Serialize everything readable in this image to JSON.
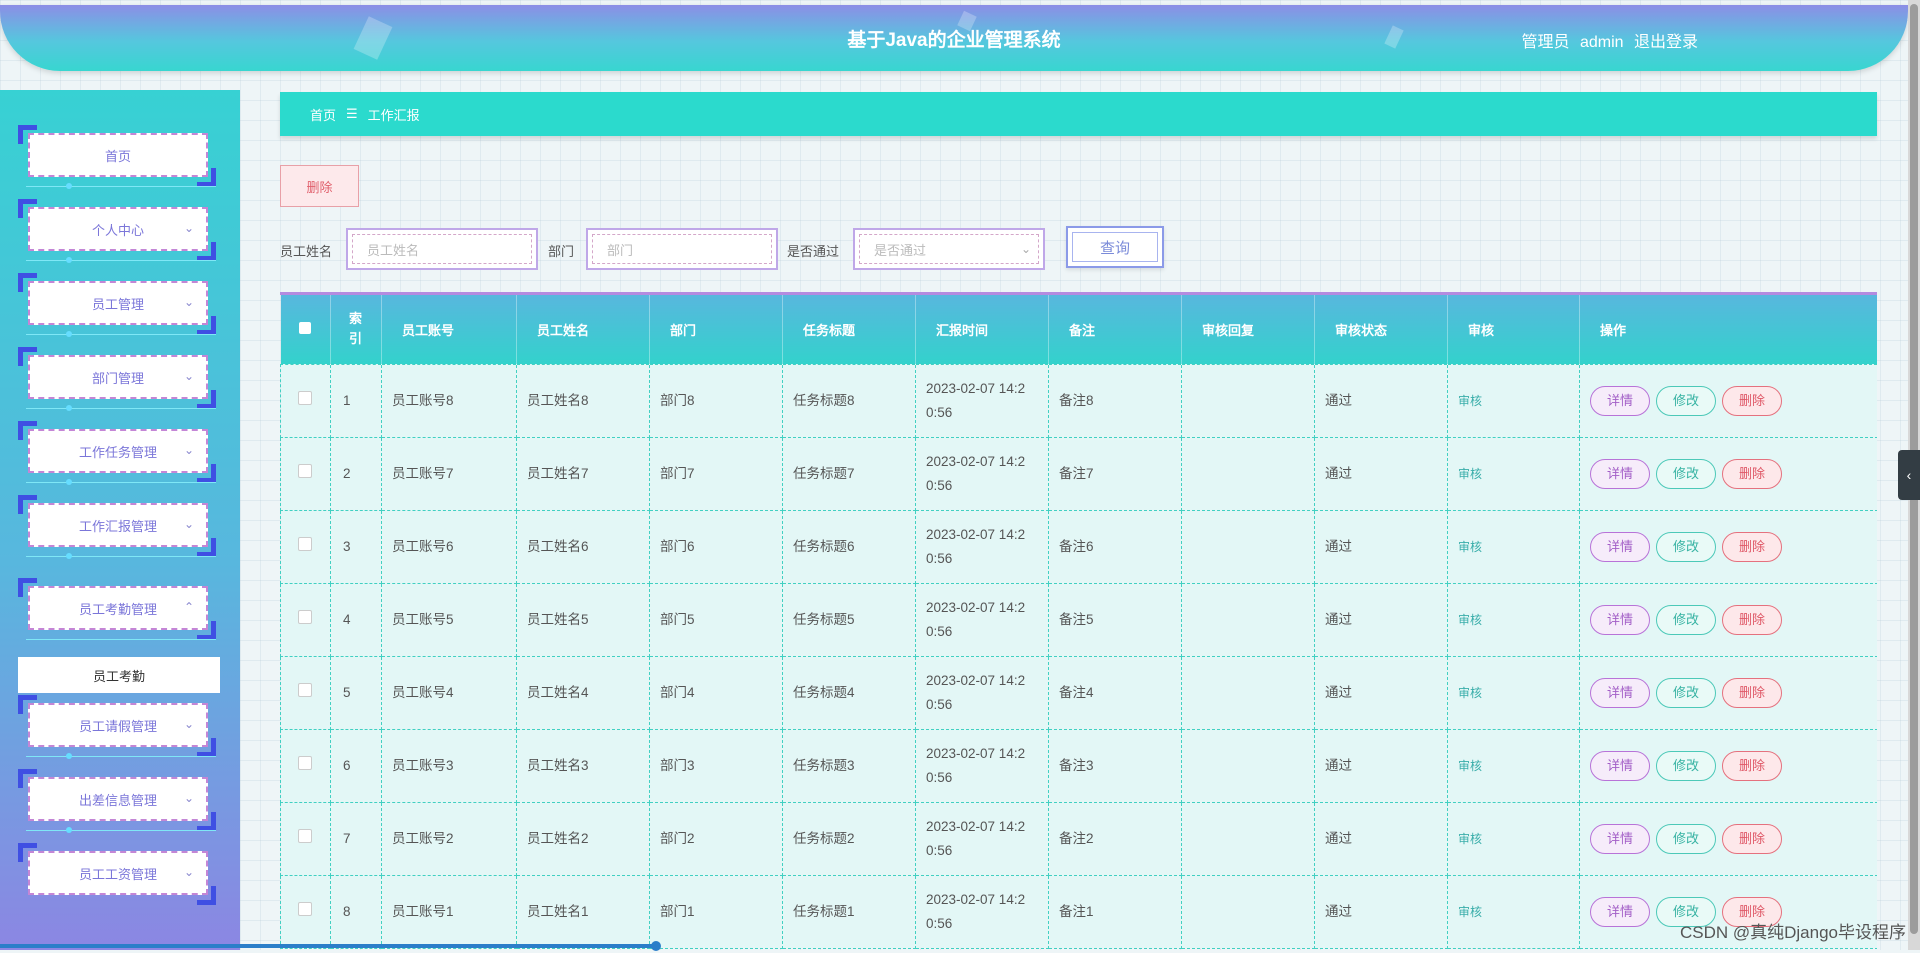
{
  "header": {
    "title": "基于Java的企业管理系统",
    "role": "管理员",
    "username": "admin",
    "logout_label": "退出登录"
  },
  "sidebar": {
    "items": [
      {
        "label": "首页"
      },
      {
        "label": "个人中心"
      },
      {
        "label": "员工管理"
      },
      {
        "label": "部门管理"
      },
      {
        "label": "工作任务管理"
      },
      {
        "label": "工作汇报管理"
      },
      {
        "label": "员工考勤管理"
      },
      {
        "label": "员工请假管理"
      },
      {
        "label": "出差信息管理"
      },
      {
        "label": "员工工资管理"
      }
    ],
    "submenu_item": "员工考勤"
  },
  "breadcrumb": {
    "home": "首页",
    "separator": "☰",
    "current": "工作汇报"
  },
  "toolbar": {
    "delete_label": "删除"
  },
  "filters": {
    "name_label": "员工姓名",
    "name_placeholder": "员工姓名",
    "dept_label": "部门",
    "dept_placeholder": "部门",
    "approved_label": "是否通过",
    "approved_placeholder": "是否通过",
    "query_label": "查询"
  },
  "table": {
    "headers": [
      "索引",
      "员工账号",
      "员工姓名",
      "部门",
      "任务标题",
      "汇报时间",
      "备注",
      "审核回复",
      "审核状态",
      "审核",
      "操作"
    ],
    "index_header_top": "索",
    "index_header_bottom": "引",
    "audit_link": "审核",
    "actions": {
      "detail": "详情",
      "edit": "修改",
      "delete": "删除"
    },
    "rows": [
      {
        "index": "1",
        "account": "员工账号8",
        "name": "员工姓名8",
        "dept": "部门8",
        "task": "任务标题8",
        "time_line1": "2023-02-07 14:2",
        "time_line2": "0:56",
        "note": "备注8",
        "reply": "",
        "status": "通过"
      },
      {
        "index": "2",
        "account": "员工账号7",
        "name": "员工姓名7",
        "dept": "部门7",
        "task": "任务标题7",
        "time_line1": "2023-02-07 14:2",
        "time_line2": "0:56",
        "note": "备注7",
        "reply": "",
        "status": "通过"
      },
      {
        "index": "3",
        "account": "员工账号6",
        "name": "员工姓名6",
        "dept": "部门6",
        "task": "任务标题6",
        "time_line1": "2023-02-07 14:2",
        "time_line2": "0:56",
        "note": "备注6",
        "reply": "",
        "status": "通过"
      },
      {
        "index": "4",
        "account": "员工账号5",
        "name": "员工姓名5",
        "dept": "部门5",
        "task": "任务标题5",
        "time_line1": "2023-02-07 14:2",
        "time_line2": "0:56",
        "note": "备注5",
        "reply": "",
        "status": "通过"
      },
      {
        "index": "5",
        "account": "员工账号4",
        "name": "员工姓名4",
        "dept": "部门4",
        "task": "任务标题4",
        "time_line1": "2023-02-07 14:2",
        "time_line2": "0:56",
        "note": "备注4",
        "reply": "",
        "status": "通过"
      },
      {
        "index": "6",
        "account": "员工账号3",
        "name": "员工姓名3",
        "dept": "部门3",
        "task": "任务标题3",
        "time_line1": "2023-02-07 14:2",
        "time_line2": "0:56",
        "note": "备注3",
        "reply": "",
        "status": "通过"
      },
      {
        "index": "7",
        "account": "员工账号2",
        "name": "员工姓名2",
        "dept": "部门2",
        "task": "任务标题2",
        "time_line1": "2023-02-07 14:2",
        "time_line2": "0:56",
        "note": "备注2",
        "reply": "",
        "status": "通过"
      },
      {
        "index": "8",
        "account": "员工账号1",
        "name": "员工姓名1",
        "dept": "部门1",
        "task": "任务标题1",
        "time_line1": "2023-02-07 14:2",
        "time_line2": "0:56",
        "note": "备注1",
        "reply": "",
        "status": "通过"
      }
    ]
  },
  "watermark": "CSDN @真纯Django毕设程序",
  "colors": {
    "accent_teal": "#2bdacd",
    "header_purple": "#8c8ee6",
    "danger": "#df5766",
    "menu_text": "#7b76d9"
  }
}
